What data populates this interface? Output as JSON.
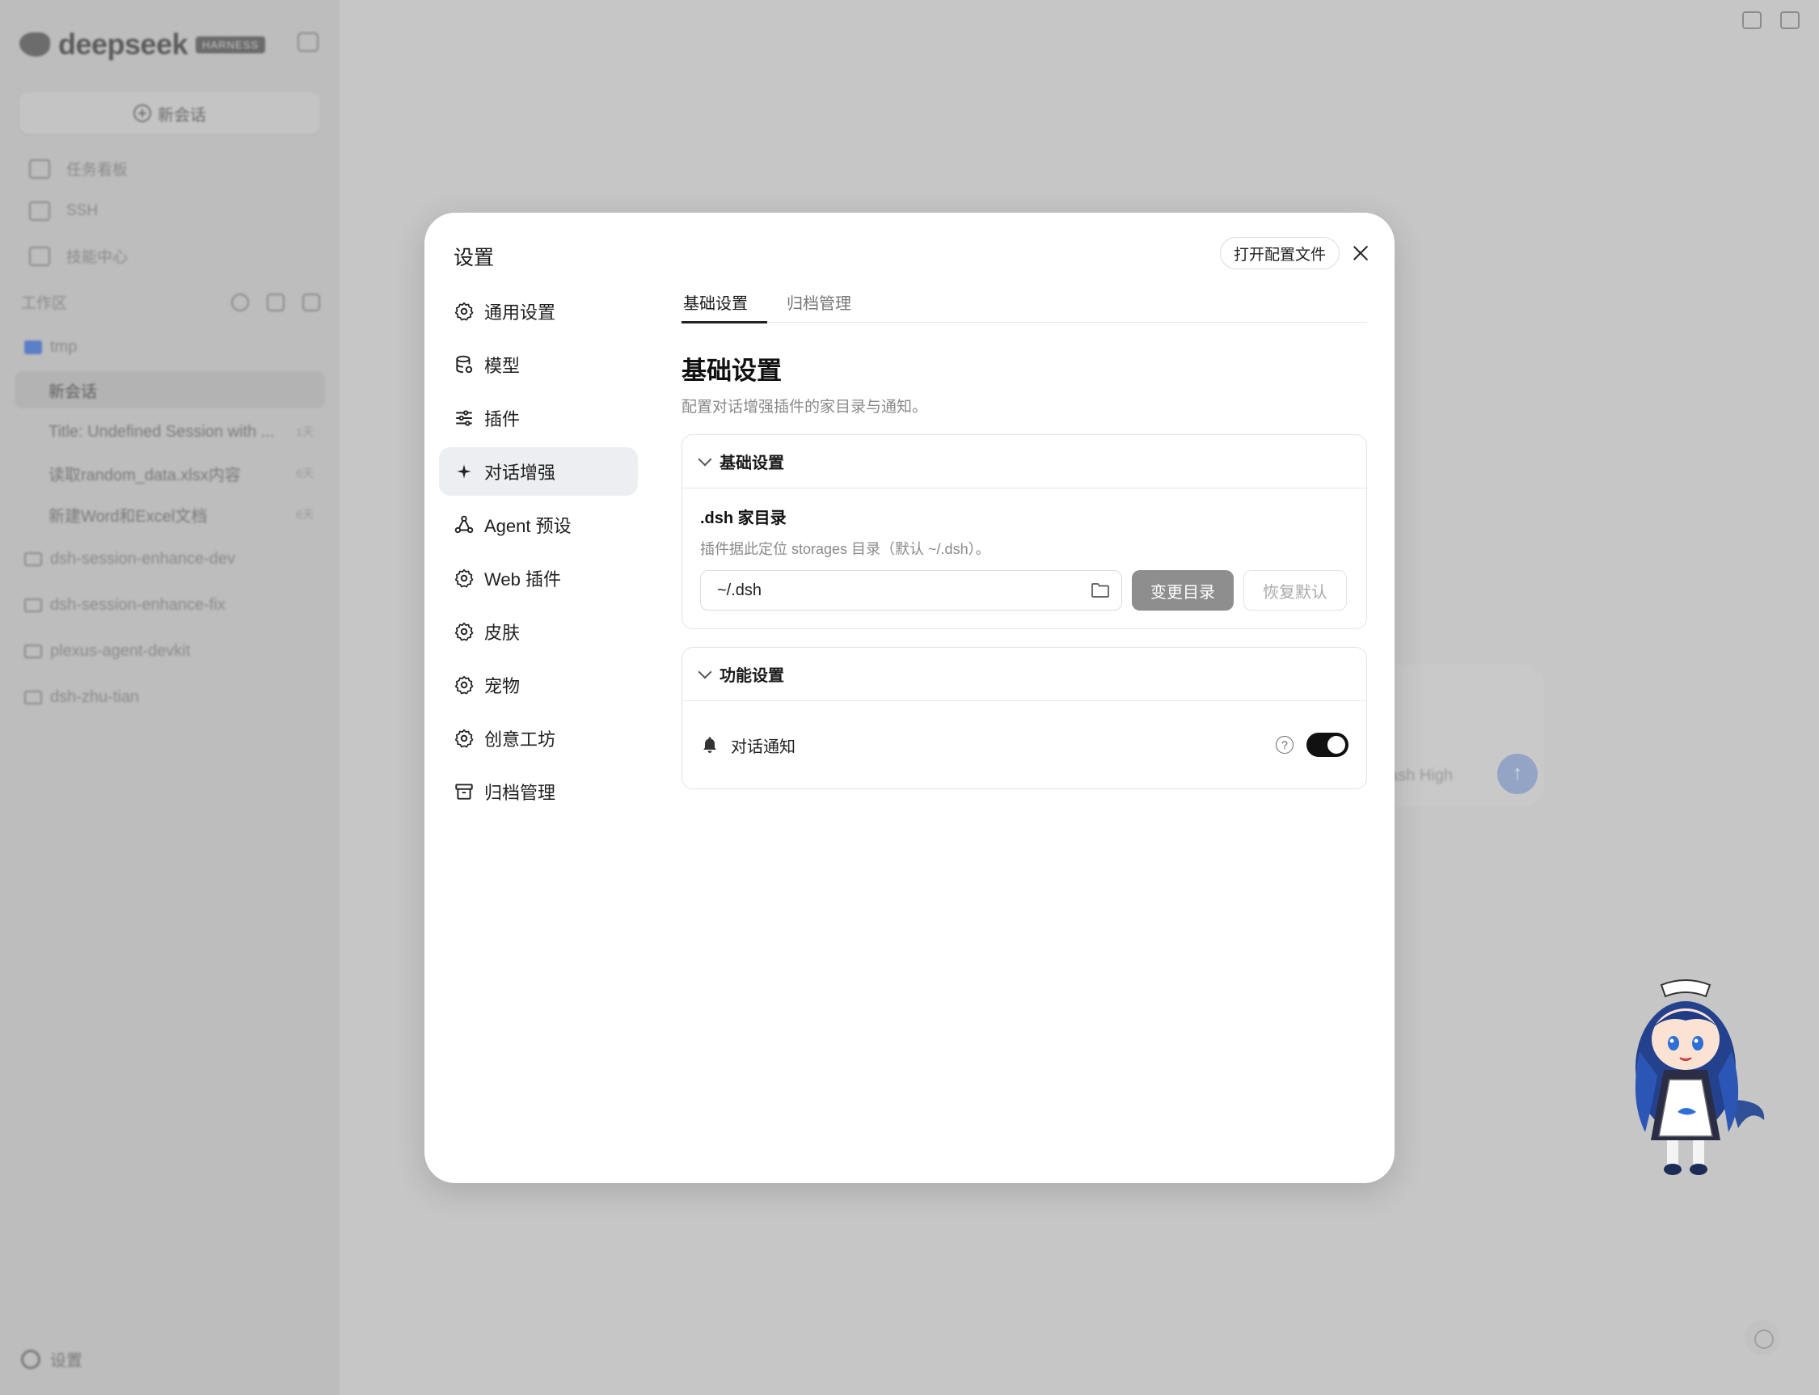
{
  "app": {
    "logo_text": "deepseek",
    "logo_badge": "HARNESS",
    "new_chat_label": "新会话",
    "nav": [
      {
        "label": "任务看板",
        "icon": "board-icon"
      },
      {
        "label": "SSH",
        "icon": "terminal-icon"
      },
      {
        "label": "技能中心",
        "icon": "skills-icon"
      }
    ],
    "workspace_label": "工作区",
    "folders": [
      {
        "name": "tmp"
      },
      {
        "name": "dsh-session-enhance-dev"
      },
      {
        "name": "dsh-session-enhance-fix"
      },
      {
        "name": "plexus-agent-devkit"
      },
      {
        "name": "dsh-zhu-tian"
      }
    ],
    "sessions": [
      {
        "title": "新会话",
        "age": ""
      },
      {
        "title": "Title: Undefined Session with ...",
        "age": "1天"
      },
      {
        "title": "读取random_data.xlsx内容",
        "age": "6天"
      },
      {
        "title": "新建Word和Excel文档",
        "age": "6天"
      }
    ],
    "settings_label": "设置",
    "model_label": "ash High"
  },
  "modal": {
    "title": "设置",
    "open_config_label": "打开配置文件",
    "menu": [
      {
        "label": "通用设置",
        "icon": "gear-icon"
      },
      {
        "label": "模型",
        "icon": "database-icon"
      },
      {
        "label": "插件",
        "icon": "sliders-icon"
      },
      {
        "label": "对话增强",
        "icon": "sparkle-icon",
        "active": true
      },
      {
        "label": "Agent 预设",
        "icon": "agent-icon"
      },
      {
        "label": "Web 插件",
        "icon": "gear-icon"
      },
      {
        "label": "皮肤",
        "icon": "gear-icon"
      },
      {
        "label": "宠物",
        "icon": "gear-icon"
      },
      {
        "label": "创意工坊",
        "icon": "gear-icon"
      },
      {
        "label": "归档管理",
        "icon": "archive-icon"
      }
    ],
    "tabs": [
      {
        "label": "基础设置",
        "active": true
      },
      {
        "label": "归档管理",
        "active": false
      }
    ],
    "section_title": "基础设置",
    "section_desc": "配置对话增强插件的家目录与通知。",
    "basic_card": {
      "title": "基础设置",
      "field_label": ".dsh 家目录",
      "field_hint": "插件据此定位 storages 目录（默认 ~/.dsh）。",
      "dir_value": "~/.dsh",
      "change_button": "变更目录",
      "reset_button": "恢复默认"
    },
    "feature_card": {
      "title": "功能设置",
      "notify_label": "对话通知",
      "help_glyph": "?",
      "notify_enabled": true
    }
  }
}
